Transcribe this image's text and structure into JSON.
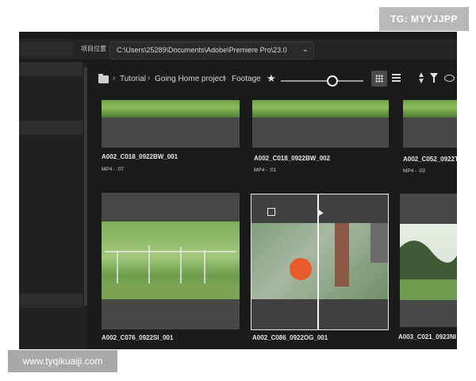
{
  "watermarks": {
    "top": "TG: MYYJJPP",
    "bottom": "www.tyqikuaiji.com"
  },
  "header": {
    "location_label": "项目位置",
    "path": "C:\\Users\\25289\\Documents\\Adobe\\Premiere Pro\\23.0"
  },
  "breadcrumb": [
    "Tutorial",
    "Going Home project",
    "Footage"
  ],
  "icons": [
    "folder-icon",
    "star-icon",
    "zoom-slider",
    "grid-view-icon",
    "list-view-icon",
    "sort-icon",
    "filter-icon",
    "eye-icon"
  ],
  "zoom_level": 0.58,
  "clips": [
    {
      "name": "A002_C018_0922BW_001",
      "meta": "MP4 - :07"
    },
    {
      "name": "A002_C018_0922BW_002",
      "meta": "MP4 - :01"
    },
    {
      "name": "A002_C052_0922T",
      "meta": "MP4 - :02"
    },
    {
      "name": "A002_C076_0922SI_001",
      "meta": ""
    },
    {
      "name": "A002_C086_0922OG_001",
      "meta": ""
    },
    {
      "name": "A003_C021_0923NI",
      "meta": ""
    }
  ],
  "colors": {
    "panel_bg": "#1b1b1b",
    "tile_bg": "#3a3a3a",
    "text": "#e6e6e6"
  }
}
